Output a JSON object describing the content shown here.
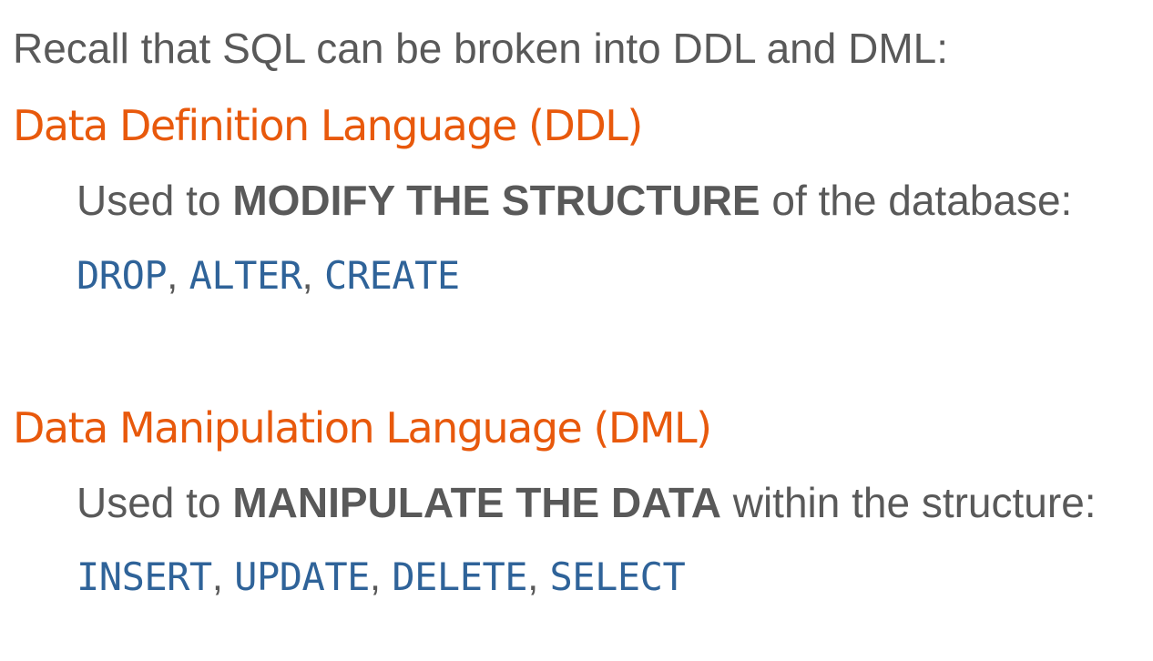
{
  "intro": {
    "text": "Recall that SQL can be broken into DDL and DML:"
  },
  "ddl": {
    "heading": "Data Definition Language (DDL)",
    "desc_prefix": "Used to ",
    "desc_bold": "MODIFY THE STRUCTURE",
    "desc_suffix": " of the database:",
    "commands": [
      "DROP",
      "ALTER",
      "CREATE"
    ]
  },
  "dml": {
    "heading": "Data Manipulation Language (DML)",
    "desc_prefix": "Used to ",
    "desc_bold": "MANIPULATE THE DATA",
    "desc_suffix": " within the structure:",
    "commands": [
      "INSERT",
      "UPDATE",
      "DELETE",
      "SELECT"
    ]
  },
  "separator": ", ",
  "colors": {
    "heading": "#e8590c",
    "body_text": "#595959",
    "keyword": "#2f6399"
  }
}
